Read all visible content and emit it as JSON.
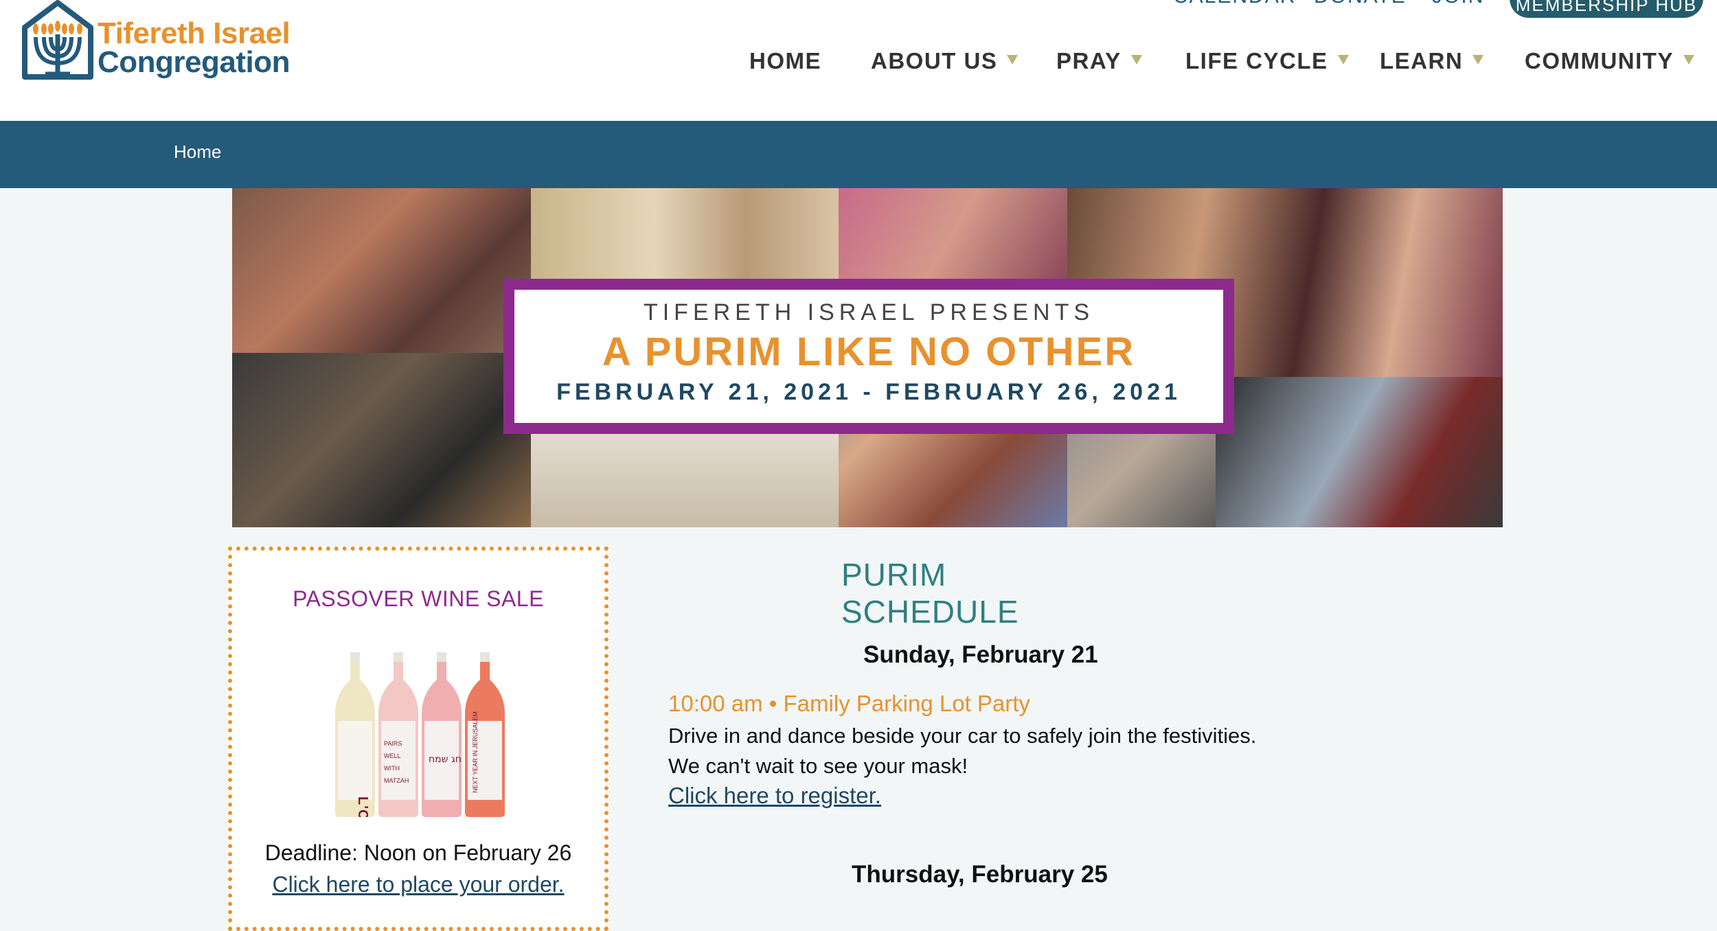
{
  "brand": {
    "name_line1": "Tifereth Israel",
    "name_line2": "Congregation",
    "colors": {
      "orange": "#e8912c",
      "blue": "#235a7c",
      "purple": "#8d2a8e",
      "teal": "#2f8080"
    }
  },
  "utility_nav": {
    "calendar": "CALENDAR",
    "donate": "DONATE",
    "join": "JOIN",
    "membership_hub": "MEMBERSHIP HUB"
  },
  "main_nav": [
    {
      "label": "HOME",
      "has_dropdown": false
    },
    {
      "label": "ABOUT US",
      "has_dropdown": true
    },
    {
      "label": "PRAY",
      "has_dropdown": true
    },
    {
      "label": "LIFE CYCLE",
      "has_dropdown": true
    },
    {
      "label": "LEARN",
      "has_dropdown": true
    },
    {
      "label": "COMMUNITY",
      "has_dropdown": true
    }
  ],
  "breadcrumb": {
    "home": "Home"
  },
  "hero": {
    "pre_title": "TIFERETH ISRAEL PRESENTS",
    "title": "A PURIM LIKE NO OTHER",
    "dates": "FEBRUARY 21, 2021 - FEBRUARY 26, 2021"
  },
  "wine_sale": {
    "title": "PASSOVER WINE SALE",
    "bottle_labels": [
      "L'CHAIM",
      "PAIRS WELL WITH MATZAH",
      "חג שמח",
      "NEXT YEAR IN JERUSALEM"
    ],
    "deadline": "Deadline: Noon on February 26",
    "order_link": "Click here to place your order."
  },
  "schedule": {
    "title": "PURIM SCHEDULE",
    "days": [
      {
        "date": "Sunday, February 21",
        "event_title": "10:00 am • Family Parking Lot Party",
        "description_lines": [
          "Drive in and dance beside your car to safely join the festivities.",
          "We can't wait to see your mask!"
        ],
        "link": "Click here to register."
      },
      {
        "date": "Thursday, February 25"
      }
    ]
  }
}
